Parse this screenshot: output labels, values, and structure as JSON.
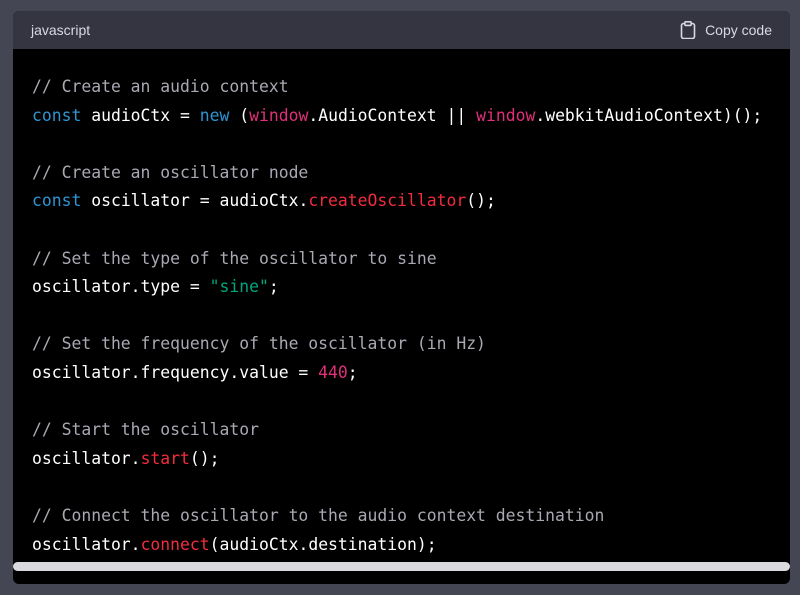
{
  "header": {
    "language": "javascript",
    "copy_label": "Copy code",
    "copy_icon": "clipboard-icon"
  },
  "colors": {
    "background": "#444654",
    "header_bg": "#343541",
    "code_bg": "#000000",
    "comment": "#a9a9b3",
    "keyword": "#2e95d3",
    "builtin": "#df3079",
    "function": "#f22c3d",
    "string": "#00a67d",
    "number": "#df3079"
  },
  "code": {
    "lines": [
      [
        {
          "t": "// Create an audio context",
          "k": "comment"
        }
      ],
      [
        {
          "t": "const",
          "k": "keyword"
        },
        {
          "t": " audioCtx = ",
          "k": "plain"
        },
        {
          "t": "new",
          "k": "keyword"
        },
        {
          "t": " (",
          "k": "plain"
        },
        {
          "t": "window",
          "k": "builtin"
        },
        {
          "t": ".AudioContext || ",
          "k": "plain"
        },
        {
          "t": "window",
          "k": "builtin"
        },
        {
          "t": ".webkitAudioContext)();",
          "k": "plain"
        }
      ],
      [],
      [
        {
          "t": "// Create an oscillator node",
          "k": "comment"
        }
      ],
      [
        {
          "t": "const",
          "k": "keyword"
        },
        {
          "t": " oscillator = audioCtx.",
          "k": "plain"
        },
        {
          "t": "createOscillator",
          "k": "func"
        },
        {
          "t": "();",
          "k": "plain"
        }
      ],
      [],
      [
        {
          "t": "// Set the type of the oscillator to sine",
          "k": "comment"
        }
      ],
      [
        {
          "t": "oscillator.type = ",
          "k": "plain"
        },
        {
          "t": "\"sine\"",
          "k": "string"
        },
        {
          "t": ";",
          "k": "plain"
        }
      ],
      [],
      [
        {
          "t": "// Set the frequency of the oscillator (in Hz)",
          "k": "comment"
        }
      ],
      [
        {
          "t": "oscillator.frequency.value = ",
          "k": "plain"
        },
        {
          "t": "440",
          "k": "number"
        },
        {
          "t": ";",
          "k": "plain"
        }
      ],
      [],
      [
        {
          "t": "// Start the oscillator",
          "k": "comment"
        }
      ],
      [
        {
          "t": "oscillator.",
          "k": "plain"
        },
        {
          "t": "start",
          "k": "func"
        },
        {
          "t": "();",
          "k": "plain"
        }
      ],
      [],
      [
        {
          "t": "// Connect the oscillator to the audio context destination",
          "k": "comment"
        }
      ],
      [
        {
          "t": "oscillator.",
          "k": "plain"
        },
        {
          "t": "connect",
          "k": "func"
        },
        {
          "t": "(audioCtx.destination);",
          "k": "plain"
        }
      ]
    ]
  }
}
